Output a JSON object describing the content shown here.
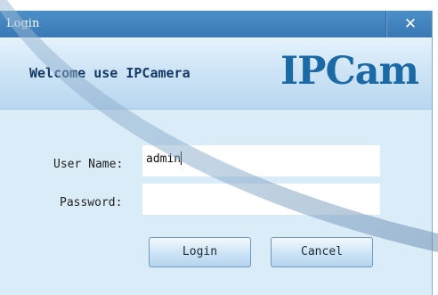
{
  "window": {
    "title": "Login",
    "close_glyph": "✕"
  },
  "banner": {
    "welcome": "Welcome use IPCamera",
    "logo": "IPCam"
  },
  "form": {
    "username_label": "User Name:",
    "username_value": "admin",
    "password_label": "Password:",
    "password_value": ""
  },
  "buttons": {
    "login": "Login",
    "cancel": "Cancel"
  },
  "colors": {
    "titlebar": "#3978b4",
    "dialog_bg": "#dbecf9",
    "logo": "#1c6aa5",
    "welcome": "#163a66"
  }
}
